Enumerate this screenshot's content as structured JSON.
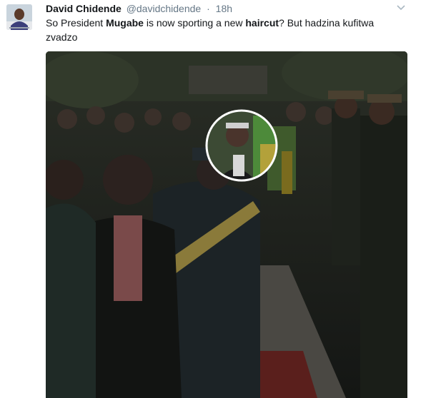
{
  "tweet": {
    "author": {
      "name": "David Chidende",
      "handle": "@davidchidende",
      "separator": "·",
      "time": "18h"
    },
    "text": {
      "part1": "So President ",
      "highlight1": "Mugabe",
      "part2": " is now sporting a new ",
      "highlight2": "haircut",
      "part3": "? But hadzina kufitwa zvadzo"
    },
    "icons": {
      "menu": "chevron-down-icon"
    },
    "media": {
      "kind": "photo",
      "highlight": "circled-face"
    },
    "colors": {
      "text": "#14171a",
      "secondary": "#657786"
    }
  }
}
